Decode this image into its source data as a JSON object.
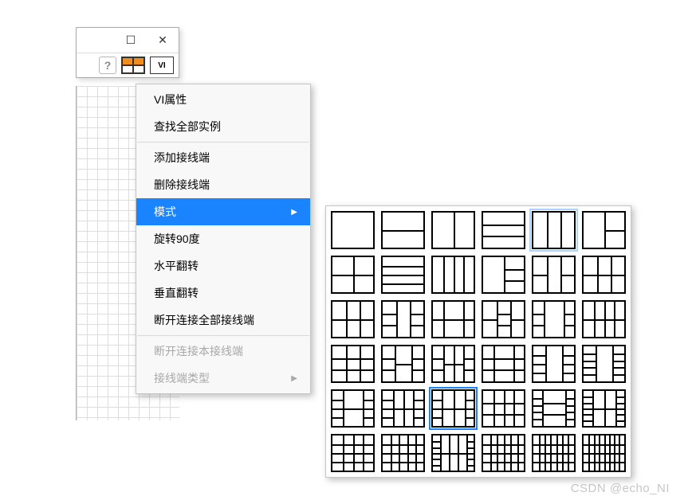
{
  "window": {
    "maximize_glyph": "☐",
    "close_glyph": "✕",
    "help_glyph": "?",
    "vi_label": "VI"
  },
  "menu": {
    "vi_properties": "VI属性",
    "find_all": "查找全部实例",
    "add_terminal": "添加接线端",
    "delete_terminal": "删除接线端",
    "patterns": "模式",
    "rotate_90": "旋转90度",
    "flip_h": "水平翻转",
    "flip_v": "垂直翻转",
    "disconnect_all": "断开连接全部接线端",
    "disconnect_this": "断开连接本接线端",
    "terminal_type": "接线端类型",
    "arrow": "▶"
  },
  "palette": {
    "rows": 6,
    "cols": 6,
    "selected_index": 26,
    "highlight_index": 4
  },
  "watermark": "CSDN @echo_NI"
}
